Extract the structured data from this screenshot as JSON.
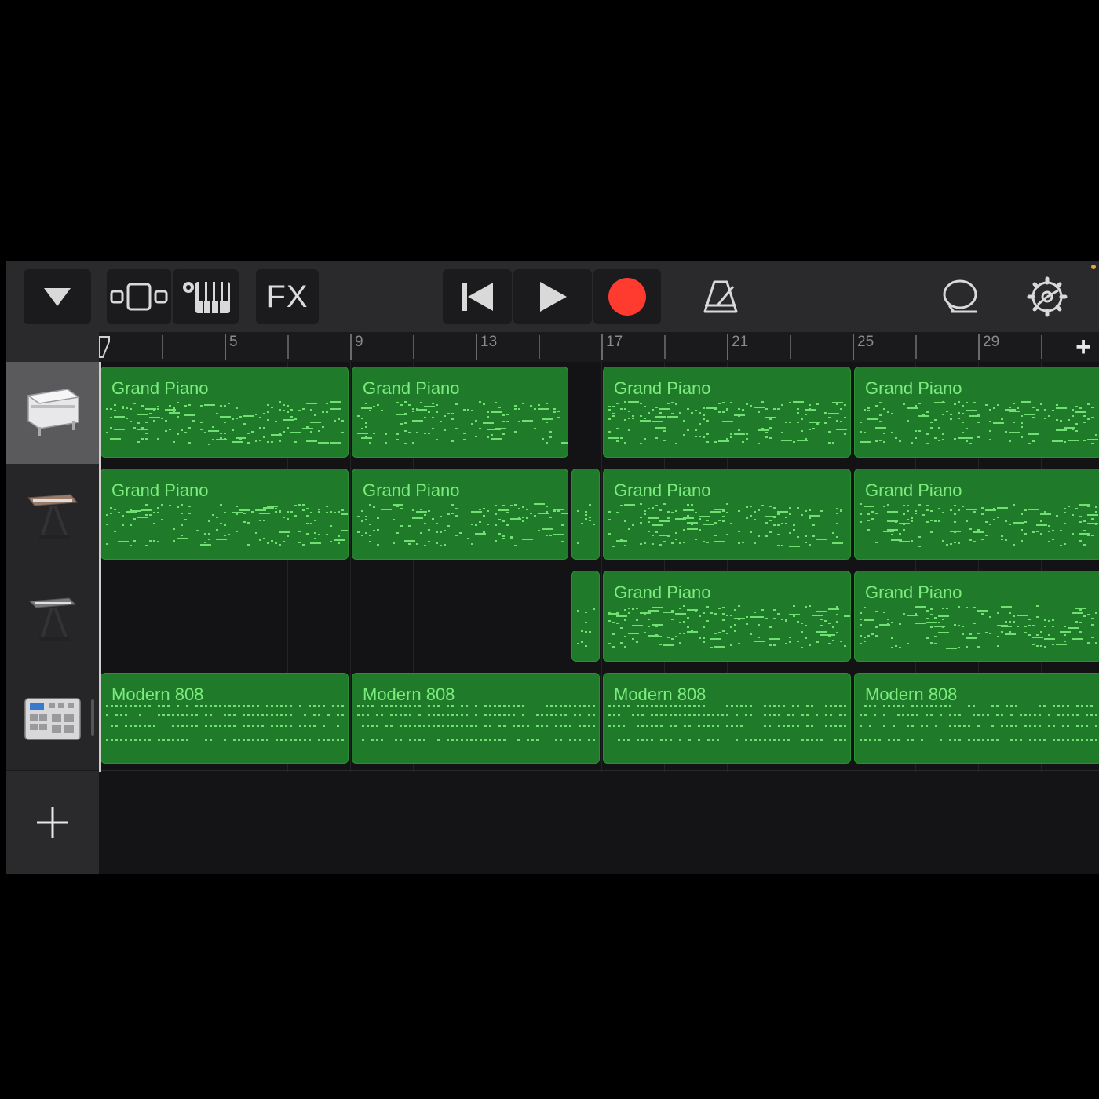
{
  "toolbar": {
    "fx_label": "FX"
  },
  "ruler": {
    "labels": [
      "5",
      "9",
      "13",
      "17",
      "21",
      "25",
      "29"
    ],
    "add_label": "+"
  },
  "tracks": [
    {
      "instrument_icon": "grand-piano-icon",
      "selected": true
    },
    {
      "instrument_icon": "electric-piano-icon",
      "selected": false
    },
    {
      "instrument_icon": "keyboard-stand-icon",
      "selected": false
    },
    {
      "instrument_icon": "drum-machine-icon",
      "selected": false
    }
  ],
  "regions": [
    {
      "track": 0,
      "start": 1,
      "end": 9,
      "label": "Grand Piano"
    },
    {
      "track": 0,
      "start": 9,
      "end": 16,
      "label": "Grand Piano"
    },
    {
      "track": 0,
      "start": 17,
      "end": 25,
      "label": "Grand Piano"
    },
    {
      "track": 0,
      "start": 25,
      "end": 33,
      "label": "Grand Piano"
    },
    {
      "track": 1,
      "start": 1,
      "end": 9,
      "label": "Grand Piano"
    },
    {
      "track": 1,
      "start": 9,
      "end": 16,
      "label": "Grand Piano"
    },
    {
      "track": 1,
      "start": 16,
      "end": 17,
      "label": ""
    },
    {
      "track": 1,
      "start": 17,
      "end": 25,
      "label": "Grand Piano"
    },
    {
      "track": 1,
      "start": 25,
      "end": 33,
      "label": "Grand Piano"
    },
    {
      "track": 2,
      "start": 16,
      "end": 17,
      "label": ""
    },
    {
      "track": 2,
      "start": 17,
      "end": 25,
      "label": "Grand Piano"
    },
    {
      "track": 2,
      "start": 25,
      "end": 33,
      "label": "Grand Piano"
    },
    {
      "track": 3,
      "start": 1,
      "end": 9,
      "label": "Modern 808"
    },
    {
      "track": 3,
      "start": 9,
      "end": 17,
      "label": "Modern 808"
    },
    {
      "track": 3,
      "start": 17,
      "end": 25,
      "label": "Modern 808"
    },
    {
      "track": 3,
      "start": 25,
      "end": 33,
      "label": "Modern 808"
    }
  ],
  "colors": {
    "region_fill": "#1f7a2a",
    "region_text": "#7dec7f",
    "record": "#ff3b30"
  }
}
